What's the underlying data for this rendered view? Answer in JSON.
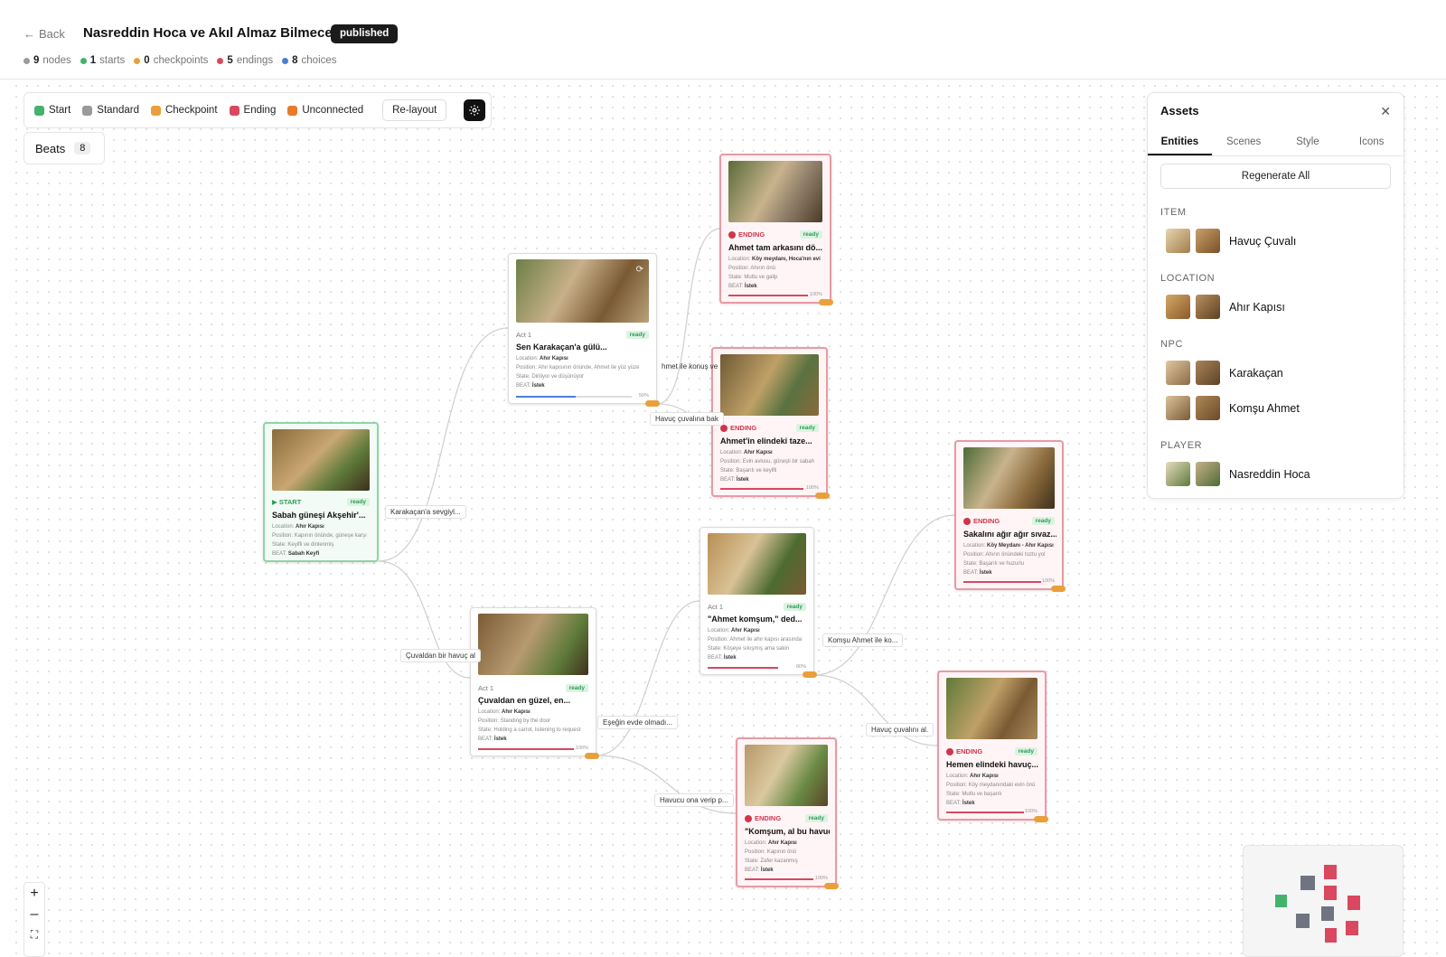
{
  "header": {
    "back_label": "Back",
    "title": "Nasreddin Hoca ve Akıl Almaz Bilmece",
    "status": "published",
    "stats": [
      {
        "value": "9",
        "label": "nodes",
        "color": "#9a9a9a"
      },
      {
        "value": "1",
        "label": "starts",
        "color": "#43b36b"
      },
      {
        "value": "0",
        "label": "checkpoints",
        "color": "#e9a03a"
      },
      {
        "value": "5",
        "label": "endings",
        "color": "#d9485f"
      },
      {
        "value": "8",
        "label": "choices",
        "color": "#4a7fd9"
      }
    ]
  },
  "legend": {
    "items": [
      {
        "label": "Start",
        "color": "#43b36b"
      },
      {
        "label": "Standard",
        "color": "#9a9a9a"
      },
      {
        "label": "Checkpoint",
        "color": "#e9a03a"
      },
      {
        "label": "Ending",
        "color": "#d9485f"
      },
      {
        "label": "Unconnected",
        "color": "#e87a2e"
      }
    ],
    "relayout_label": "Re-layout",
    "settings_icon": "gear-icon"
  },
  "beats": {
    "label": "Beats",
    "count": "8"
  },
  "nodes": [
    {
      "kind": "START",
      "type": "start",
      "status": "ready",
      "title": "Sabah güneşi Akşehir'...",
      "location": "Ahır Kapısı",
      "position": "Kapının önünde, güneşe karşı",
      "state": "Keyifli ve dinlenmiş",
      "beat": "Sabah Keyfi",
      "pct": ""
    },
    {
      "kind": "Act 1",
      "type": "standard",
      "status": "ready",
      "title": "Sen Karakaçan'a gülü...",
      "location": "Ahır Kapısı",
      "position": "Ahır kapısının önünde, Ahmet ile yüz yüze",
      "state": "Diriliyor ve düşünüyor",
      "beat": "İstek",
      "pct": "50%"
    },
    {
      "kind": "Act 1",
      "type": "standard",
      "status": "ready",
      "title": "Çuvaldan en güzel, en...",
      "location": "Ahır Kapısı",
      "position": "Standing by the door",
      "state": "Holding a carrot, listening to request",
      "beat": "İstek",
      "pct": "100%"
    },
    {
      "kind": "Act 1",
      "type": "standard",
      "status": "ready",
      "title": "\"Ahmet komşum,\" ded...",
      "location": "Ahır Kapısı",
      "position": "Ahmet ile ahır kapısı arasında",
      "state": "Köşeye sıkışmış ama sakin",
      "beat": "İstek",
      "pct": "80%"
    },
    {
      "kind": "ENDING",
      "type": "ending",
      "status": "ready",
      "title": "Ahmet tam arkasını dö...",
      "location": "Köy meydanı, Hoca'nın evi",
      "position": "Ahırın önü",
      "state": "Mutlu ve galip",
      "beat": "İstek",
      "pct": "100%"
    },
    {
      "kind": "ENDING",
      "type": "ending",
      "status": "ready",
      "title": "Ahmet'in elindeki taze...",
      "location": "Ahır Kapısı",
      "position": "Evin avlusu, güneşli bir sabah",
      "state": "Başarılı ve keyifli",
      "beat": "İstek",
      "pct": "100%"
    },
    {
      "kind": "ENDING",
      "type": "ending",
      "status": "ready",
      "title": "Sakalını ağır ağır sıvaz...",
      "location": "Köy Meydanı - Ahır Kapısı",
      "position": "Ahırın önündeki toztu yol",
      "state": "Başarılı ve huzurlu",
      "beat": "İstek",
      "pct": "100%"
    },
    {
      "kind": "ENDING",
      "type": "ending",
      "status": "ready",
      "title": "Hemen elindeki havuç...",
      "location": "Ahır Kapısı",
      "position": "Köy meydanındaki evin önü",
      "state": "Mutlu ve başarılı",
      "beat": "İstek",
      "pct": "100%"
    },
    {
      "kind": "ENDING",
      "type": "ending",
      "status": "ready",
      "title": "\"Komşum, al bu havuc...",
      "location": "Ahır Kapısı",
      "position": "Kapının önü",
      "state": "Zafer kazanmış",
      "beat": "İstek",
      "pct": "100%"
    }
  ],
  "field_labels": {
    "location": "Location:",
    "position": "Position:",
    "state": "State:",
    "beat": "BEAT:"
  },
  "edge_labels": [
    "Karakaçan'a sevgiyl...",
    "Çuvaldan bir havuç al",
    "hmet ile konuş ve",
    "Havuç çuvalına bak",
    "Eşeğin evde olmadı...",
    "Komşu Ahmet ile ko...",
    "Havuç çuvalını al.",
    "Havucu ona verip p..."
  ],
  "assets": {
    "title": "Assets",
    "close_icon": "close-icon",
    "tabs": [
      "Entities",
      "Scenes",
      "Style",
      "Icons"
    ],
    "active_tab": "Entities",
    "regenerate_label": "Regenerate All",
    "sections": [
      {
        "name": "ITEM",
        "entities": [
          "Havuç Çuvalı"
        ]
      },
      {
        "name": "LOCATION",
        "entities": [
          "Ahır Kapısı"
        ]
      },
      {
        "name": "NPC",
        "entities": [
          "Karakaçan",
          "Komşu Ahmet"
        ]
      },
      {
        "name": "PLAYER",
        "entities": [
          "Nasreddin Hoca"
        ]
      }
    ]
  },
  "zoom": {
    "in": "+",
    "out": "–",
    "fit": "⛶"
  }
}
